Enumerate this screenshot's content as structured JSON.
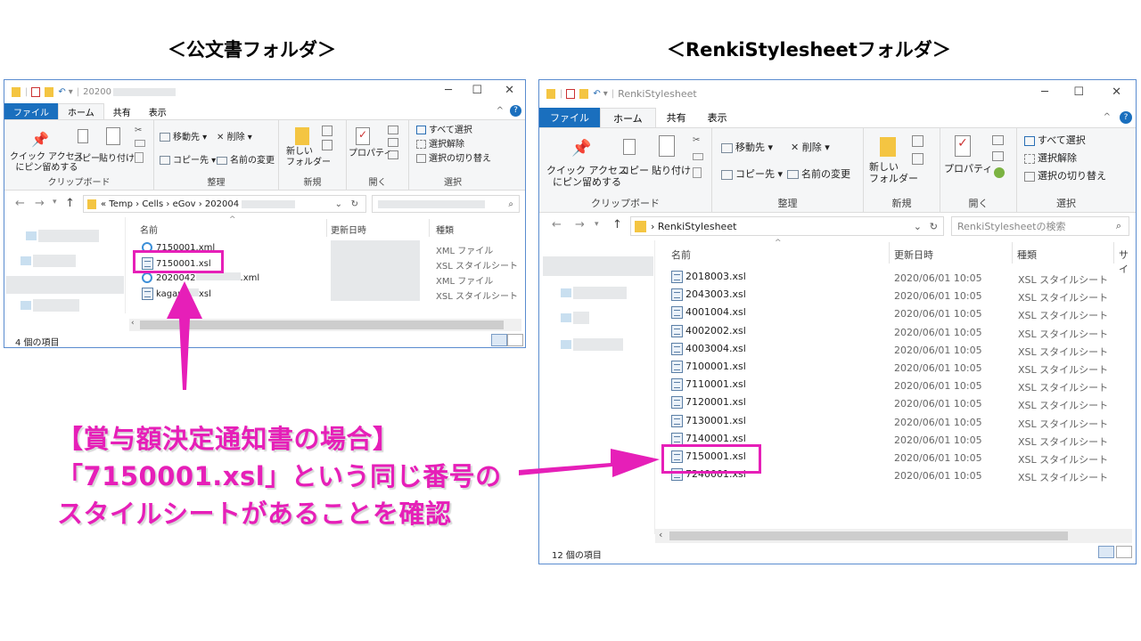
{
  "headings": {
    "left": "＜公文書フォルダ＞",
    "right": "＜RenkiStylesheetフォルダ＞"
  },
  "ribbon": {
    "menu": {
      "file": "ファイル",
      "home": "ホーム",
      "share": "共有",
      "view": "表示"
    },
    "clipboard": {
      "pin": "クイック アクセス\nにピン留めする",
      "copy": "コピー",
      "paste": "貼り付け",
      "label": "クリップボード"
    },
    "organize": {
      "move": "移動先",
      "copyto": "コピー先",
      "delete": "削除",
      "rename": "名前の変更",
      "label": "整理"
    },
    "new": {
      "folder": "新しい\nフォルダー",
      "label": "新規"
    },
    "open": {
      "properties": "プロパティ",
      "label": "開く"
    },
    "select": {
      "all": "すべて選択",
      "none": "選択解除",
      "invert": "選択の切り替え",
      "label": "選択"
    }
  },
  "left_window": {
    "title": "20200",
    "breadcrumb": [
      "«",
      "Temp",
      "Cells",
      "eGov",
      "202004"
    ],
    "columns": {
      "name": "名前",
      "date": "更新日時",
      "type": "種類"
    },
    "files": [
      {
        "name": "7150001.xml",
        "type": "XML ファイル"
      },
      {
        "name": "7150001.xsl",
        "type": "XSL スタイルシート"
      },
      {
        "name": "2020042",
        "suffix": ".xml",
        "type": "XML ファイル"
      },
      {
        "name": "kagam",
        "suffix": "xsl",
        "type": "XSL スタイルシート"
      }
    ],
    "status": "4 個の項目"
  },
  "right_window": {
    "title": "RenkiStylesheet",
    "breadcrumb": [
      "RenkiStylesheet"
    ],
    "search_placeholder": "RenkiStylesheetの検索",
    "columns": {
      "name": "名前",
      "date": "更新日時",
      "type": "種類",
      "size": "サイ"
    },
    "files": [
      {
        "name": "2018003.xsl",
        "date": "2020/06/01 10:05",
        "type": "XSL スタイルシート"
      },
      {
        "name": "2043003.xsl",
        "date": "2020/06/01 10:05",
        "type": "XSL スタイルシート"
      },
      {
        "name": "4001004.xsl",
        "date": "2020/06/01 10:05",
        "type": "XSL スタイルシート"
      },
      {
        "name": "4002002.xsl",
        "date": "2020/06/01 10:05",
        "type": "XSL スタイルシート"
      },
      {
        "name": "4003004.xsl",
        "date": "2020/06/01 10:05",
        "type": "XSL スタイルシート"
      },
      {
        "name": "7100001.xsl",
        "date": "2020/06/01 10:05",
        "type": "XSL スタイルシート"
      },
      {
        "name": "7110001.xsl",
        "date": "2020/06/01 10:05",
        "type": "XSL スタイルシート"
      },
      {
        "name": "7120001.xsl",
        "date": "2020/06/01 10:05",
        "type": "XSL スタイルシート"
      },
      {
        "name": "7130001.xsl",
        "date": "2020/06/01 10:05",
        "type": "XSL スタイルシート"
      },
      {
        "name": "7140001.xsl",
        "date": "2020/06/01 10:05",
        "type": "XSL スタイルシート"
      },
      {
        "name": "7150001.xsl",
        "date": "2020/06/01 10:05",
        "type": "XSL スタイルシート"
      },
      {
        "name": "7240001.xsl",
        "date": "2020/06/01 10:05",
        "type": "XSL スタイルシート"
      }
    ],
    "status": "12 個の項目"
  },
  "annotation": {
    "line1": "【賞与額決定通知書の場合】",
    "line2": "「7150001.xsl」という同じ番号の",
    "line3": "スタイルシートがあることを確認"
  },
  "colors": {
    "accent": "#e61fb8",
    "file_tab": "#1a6fbe"
  }
}
